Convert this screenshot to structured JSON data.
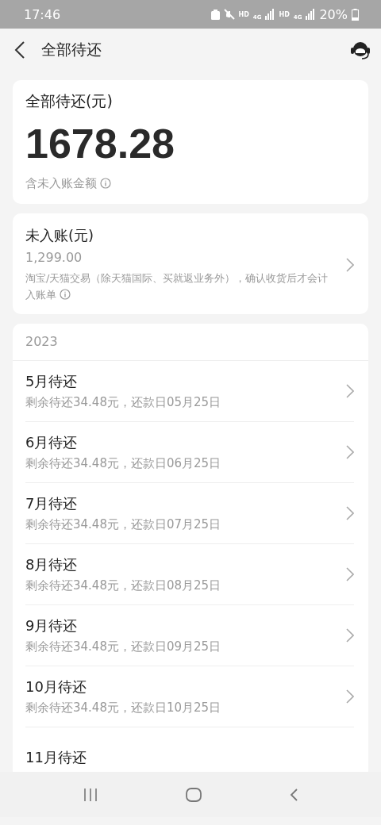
{
  "status_bar": {
    "time": "17:46",
    "network_1": "HD",
    "network_1_type": "4G",
    "network_2": "HD",
    "network_2_type": "4G",
    "battery": "20%"
  },
  "header": {
    "title": "全部待还"
  },
  "total_card": {
    "label": "全部待还(元)",
    "amount": "1678.28",
    "note": "含未入账金额"
  },
  "unbilled_card": {
    "label": "未入账(元)",
    "amount": "1,299.00",
    "note": "淘宝/天猫交易（除天猫国际、买就返业务外），确认收货后才会计入账单"
  },
  "bills": {
    "year": "2023",
    "rows": [
      {
        "title": "5月待还",
        "detail": "剩余待还34.48元，还款日05月25日"
      },
      {
        "title": "6月待还",
        "detail": "剩余待还34.48元，还款日06月25日"
      },
      {
        "title": "7月待还",
        "detail": "剩余待还34.48元，还款日07月25日"
      },
      {
        "title": "8月待还",
        "detail": "剩余待还34.48元，还款日08月25日"
      },
      {
        "title": "9月待还",
        "detail": "剩余待还34.48元，还款日09月25日"
      },
      {
        "title": "10月待还",
        "detail": "剩余待还34.48元，还款日10月25日"
      },
      {
        "title": "11月待还"
      }
    ]
  }
}
